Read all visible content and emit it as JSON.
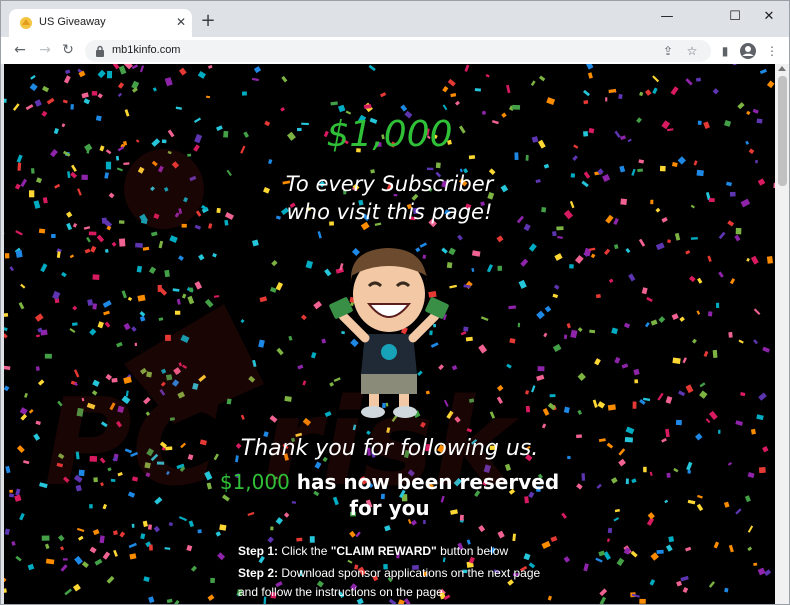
{
  "browser": {
    "tab_title": "US Giveaway",
    "url": "mb1kinfo.com",
    "new_tab_symbol": "+",
    "icons": [
      "back-icon",
      "forward-icon",
      "reload-icon",
      "lock-icon",
      "share-icon",
      "star-icon",
      "side-panel-icon",
      "profile-icon",
      "menu-icon",
      "minimize-icon",
      "maximize-icon",
      "close-icon"
    ]
  },
  "page": {
    "amount": "$1,000",
    "tagline_line1": "To every Subscriber",
    "tagline_line2": "who visit this page!",
    "thanks": "Thank you for following us.",
    "reserved_amount": "$1,000",
    "reserved_text": " has now been reserved",
    "reserved_line2": "for you",
    "steps": [
      {
        "label": "Step 1:",
        "text": " Click the ",
        "bold_text": "\"CLAIM REWARD\"",
        "rest": " button below"
      },
      {
        "label": "Step 2:",
        "text": " Download sponsor applications on the next page and follow the instructions on the page"
      }
    ],
    "colors": {
      "accent_green": "#2fc038",
      "background": "#000000",
      "text": "#ffffff"
    }
  }
}
